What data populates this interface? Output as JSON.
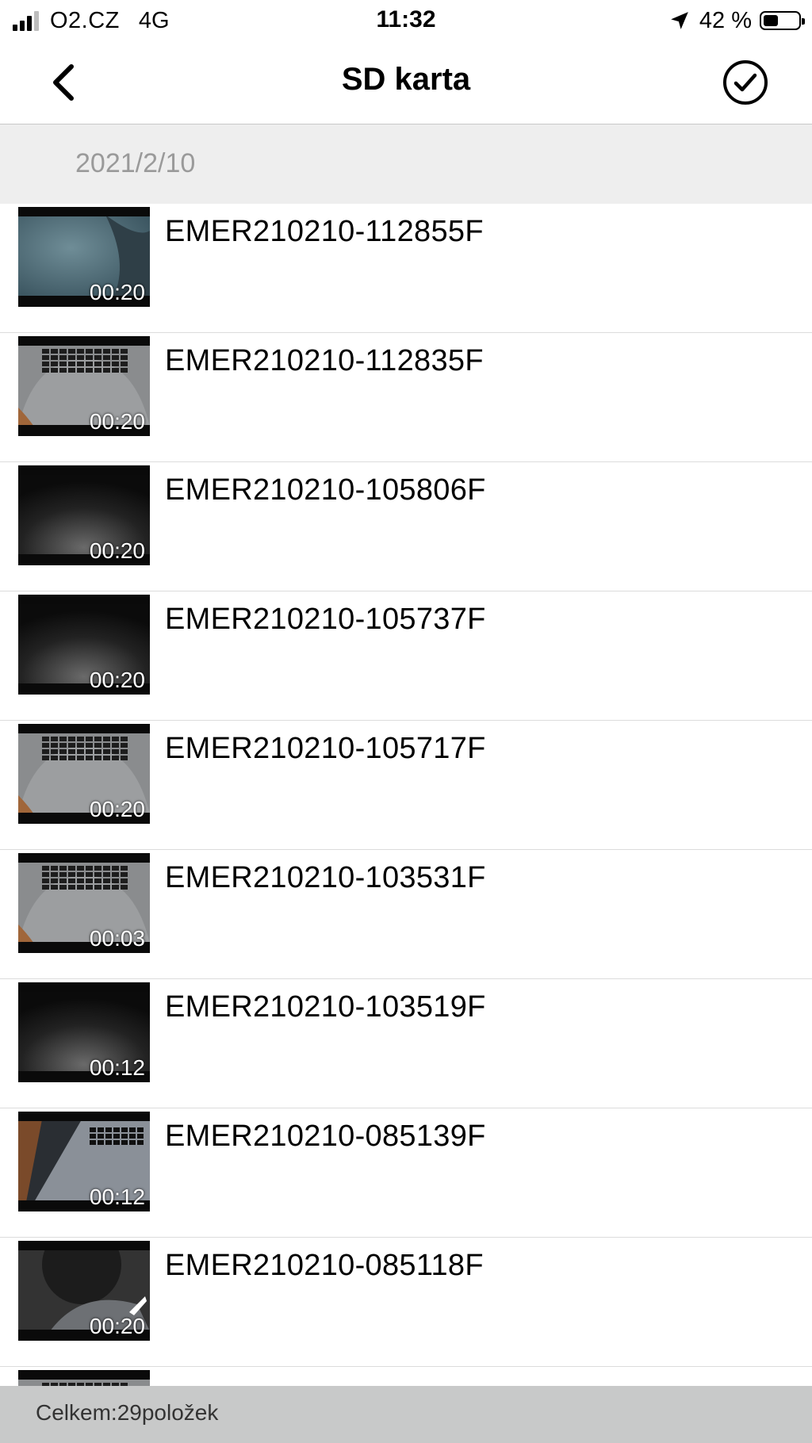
{
  "status_bar": {
    "carrier": "O2.CZ",
    "network": "4G",
    "time": "11:32",
    "battery_percent": "42 %",
    "battery_level": 0.42,
    "signal_bars": 4,
    "signal_bars_active": 3,
    "icons": [
      "signal-icon",
      "location-arrow-icon",
      "battery-icon"
    ]
  },
  "nav": {
    "title": "SD karta",
    "back_icon": "chevron-left-icon",
    "select_icon": "checkmark-circle-icon"
  },
  "section": {
    "date": "2021/2/10"
  },
  "files": [
    {
      "name": "EMER210210-112855F",
      "duration": "00:20",
      "thumb_style": "fabric"
    },
    {
      "name": "EMER210210-112835F",
      "duration": "00:20",
      "thumb_style": "keyboard"
    },
    {
      "name": "EMER210210-105806F",
      "duration": "00:20",
      "thumb_style": "dark"
    },
    {
      "name": "EMER210210-105737F",
      "duration": "00:20",
      "thumb_style": "dark"
    },
    {
      "name": "EMER210210-105717F",
      "duration": "00:20",
      "thumb_style": "keyboard"
    },
    {
      "name": "EMER210210-103531F",
      "duration": "00:03",
      "thumb_style": "keyboard"
    },
    {
      "name": "EMER210210-103519F",
      "duration": "00:12",
      "thumb_style": "dark"
    },
    {
      "name": "EMER210210-085139F",
      "duration": "00:12",
      "thumb_style": "laptop"
    },
    {
      "name": "EMER210210-085118F",
      "duration": "00:20",
      "thumb_style": "dim"
    },
    {
      "name": "",
      "duration": "",
      "thumb_style": "keyboard"
    }
  ],
  "footer": {
    "total_text": "Celkem:29položek"
  },
  "colors": {
    "section_bg": "#eeeeee",
    "section_text": "#9a9a9a",
    "footer_bg": "#c8c9c9",
    "divider": "#dcdcdc"
  }
}
